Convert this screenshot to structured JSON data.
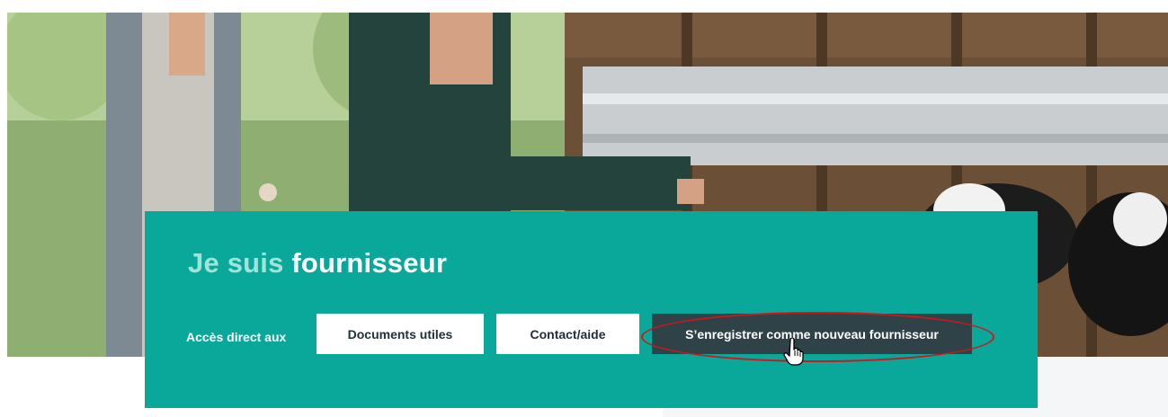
{
  "hero": {
    "title_prefix": "Je suis",
    "title_main": "fournisseur"
  },
  "access": {
    "label": "Accès direct aux",
    "buttons": [
      {
        "label": "Documents utiles"
      },
      {
        "label": "Contact/aide"
      },
      {
        "label": "S’enregistrer comme nouveau fournisseur"
      }
    ]
  },
  "colors": {
    "panel": "#0aa89a",
    "title_prefix": "#9fe3d9",
    "dark_button": "#2e4248",
    "highlight": "#d0161a"
  },
  "icons": {
    "cursor": "hand-pointer-icon"
  }
}
